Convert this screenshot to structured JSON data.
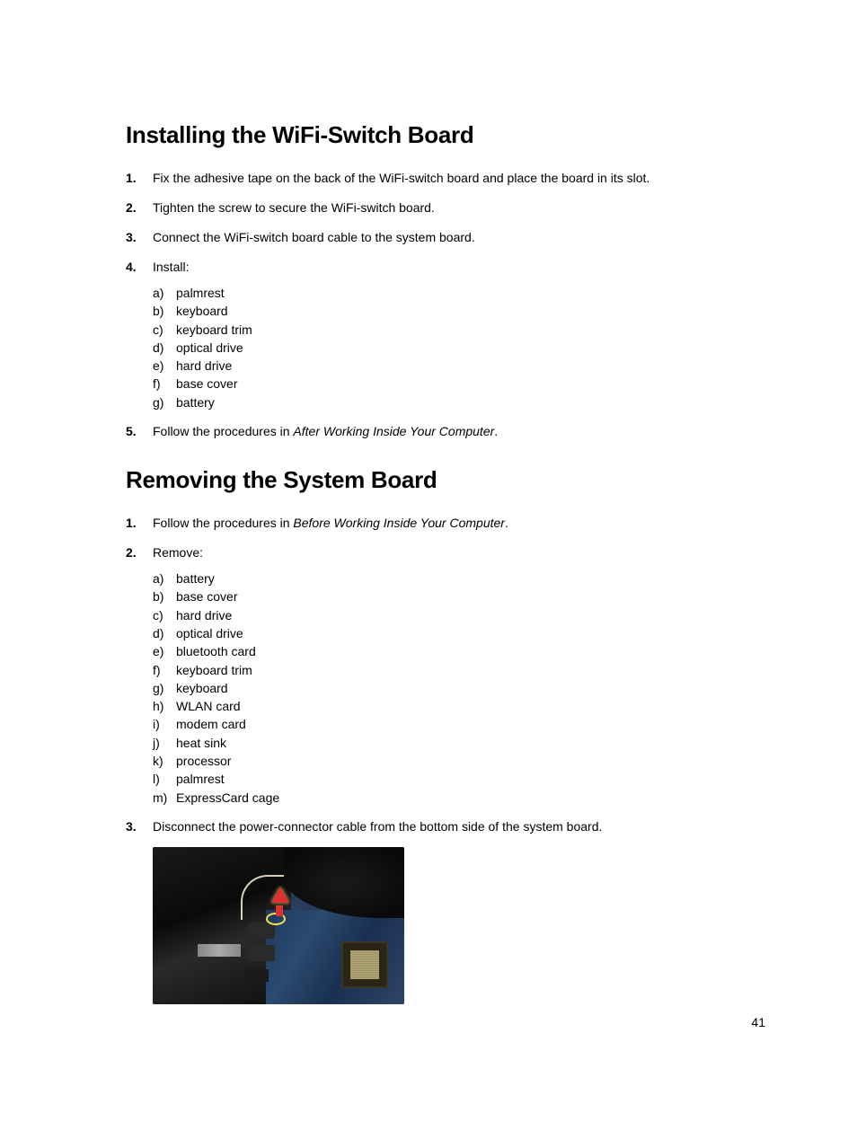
{
  "section1": {
    "title": "Installing the WiFi-Switch Board",
    "steps": [
      {
        "text": "Fix the adhesive tape on the back of the WiFi-switch board and place the board in its slot."
      },
      {
        "text": "Tighten the screw to secure the WiFi-switch board."
      },
      {
        "text": "Connect the WiFi-switch board cable to the system board."
      },
      {
        "text": "Install:",
        "sub": [
          "palmrest",
          "keyboard",
          "keyboard trim",
          "optical drive",
          "hard drive",
          "base cover",
          "battery"
        ]
      },
      {
        "prefix": "Follow the procedures in ",
        "italic": "After Working Inside Your Computer",
        "suffix": "."
      }
    ]
  },
  "section2": {
    "title": "Removing the System Board",
    "steps": [
      {
        "prefix": "Follow the procedures in ",
        "italic": "Before Working Inside Your Computer",
        "suffix": "."
      },
      {
        "text": "Remove:",
        "sub": [
          "battery",
          "base cover",
          "hard drive",
          "optical drive",
          "bluetooth card",
          "keyboard trim",
          "keyboard",
          "WLAN card",
          "modem card",
          "heat sink",
          "processor",
          "palmrest",
          "ExpressCard cage"
        ]
      },
      {
        "text": "Disconnect the power-connector cable from the bottom side of the system board."
      }
    ]
  },
  "figure_alt": "System board power-connector cable disconnect location",
  "page_number": "41"
}
